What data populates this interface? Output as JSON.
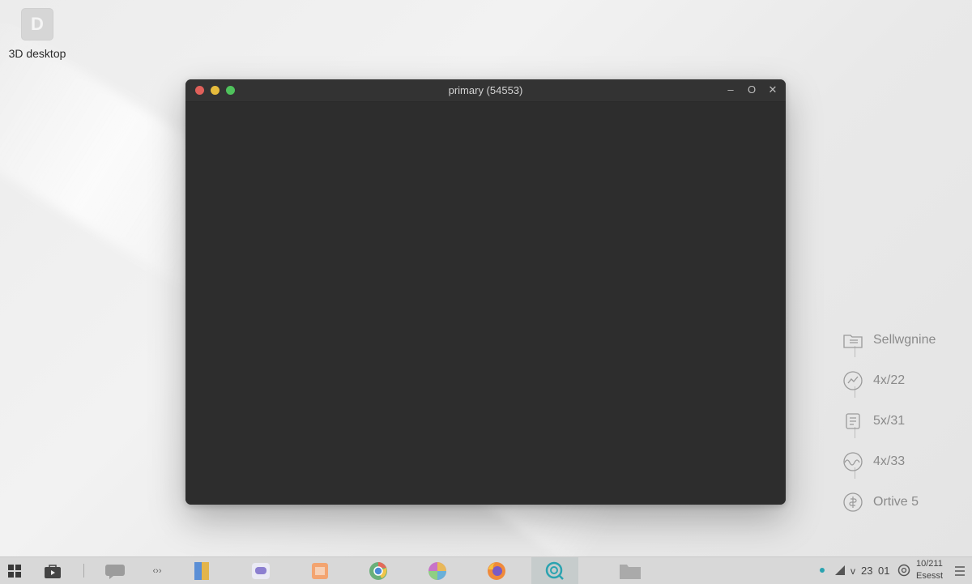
{
  "desktop": {
    "icon_glyph": "D",
    "icon_label": "3D desktop"
  },
  "window": {
    "title": "primary (54553)",
    "controls": {
      "minimize": "–",
      "maximize": "O",
      "close": "✕"
    }
  },
  "side_panel": {
    "items": [
      {
        "label": "Sellwgnine",
        "icon": "folder-icon"
      },
      {
        "label": "4x/22",
        "icon": "chart-circle-icon"
      },
      {
        "label": "5x/31",
        "icon": "document-icon"
      },
      {
        "label": "4x/33",
        "icon": "wave-icon"
      },
      {
        "label": "Ortive 5",
        "icon": "coin-icon"
      }
    ]
  },
  "taskbar": {
    "apps": [
      "start-icon",
      "store-icon",
      "chat-icon",
      "code-icon",
      "book-icon",
      "message-icon",
      "calendar-icon",
      "chrome-icon",
      "color-wheel-icon",
      "firefox-icon",
      "search-app-icon",
      "folder-app-icon"
    ],
    "code_glyph": "‹››",
    "tray": {
      "signal_text": "v",
      "numbers": "23",
      "count": "01",
      "time": "10/211",
      "date": "Esesst"
    }
  }
}
